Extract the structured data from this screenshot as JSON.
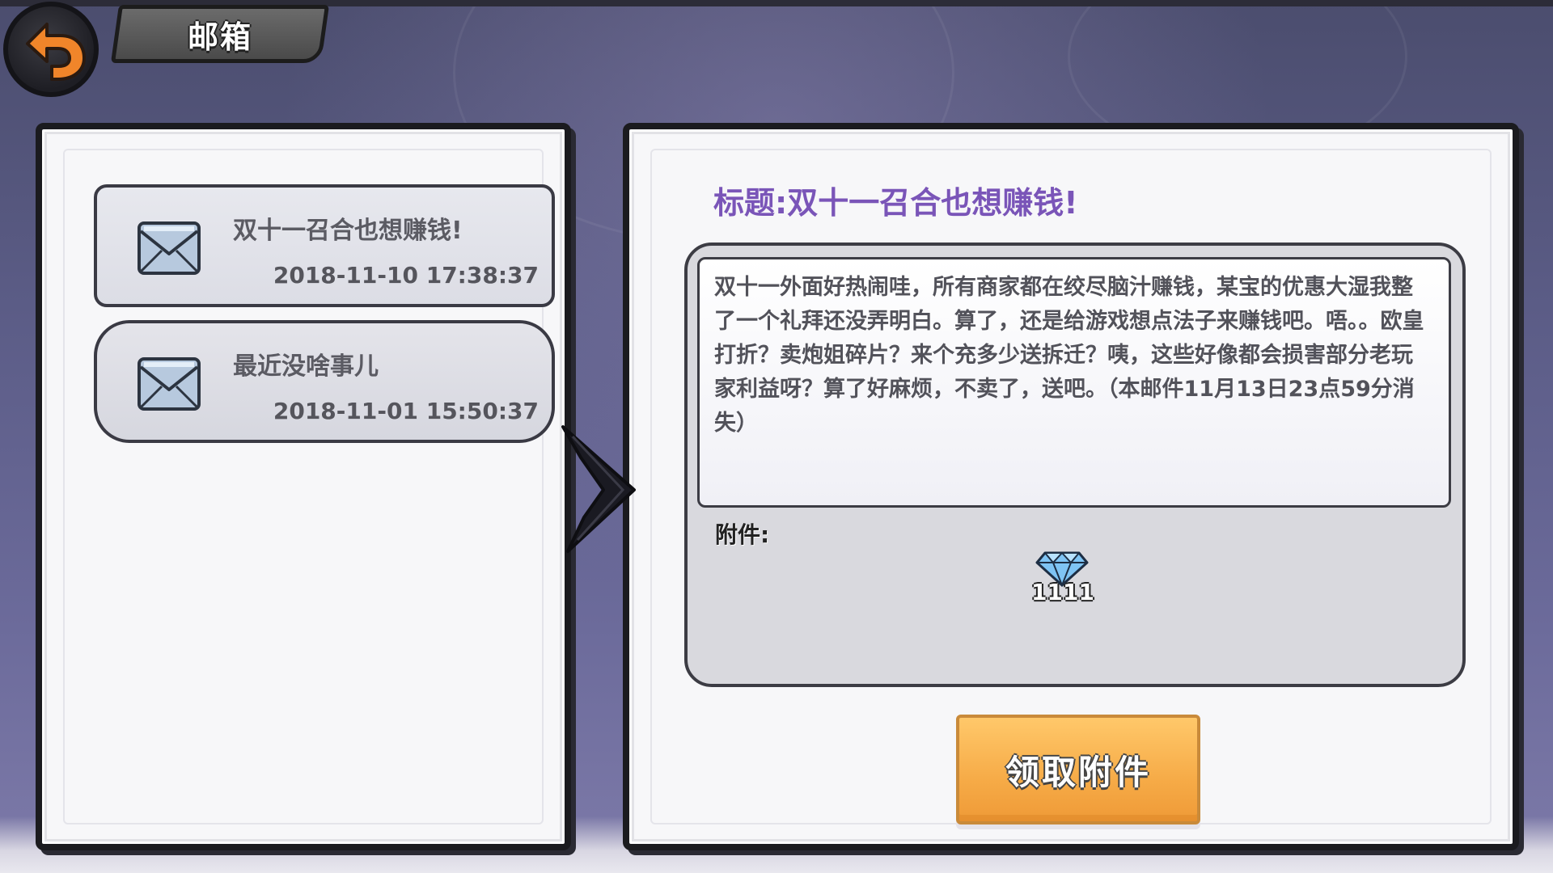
{
  "header": {
    "title": "邮箱",
    "back_icon": "back-arrow-icon"
  },
  "mail_list": {
    "items": [
      {
        "subject": "双十一召合也想赚钱!",
        "date": "2018-11-10 17:38:37",
        "icon": "envelope-icon"
      },
      {
        "subject": "最近没啥事儿",
        "date": "2018-11-01 15:50:37",
        "icon": "envelope-icon"
      }
    ]
  },
  "mail_detail": {
    "title_prefix": "标题:",
    "title": "双十一召合也想赚钱!",
    "body": "双十一外面好热闹哇，所有商家都在绞尽脑汁赚钱，某宝的优惠大湿我整了一个礼拜还没弄明白。算了，还是给游戏想点法子来赚钱吧。唔。。欧皇打折？卖炮姐碎片？来个充多少送拆迁？咦，这些好像都会损害部分老玩家利益呀？算了好麻烦，不卖了，送吧。（本邮件11月13日23点59分消失）",
    "attachment_label": "附件:",
    "attachments": [
      {
        "icon": "diamond-icon",
        "quantity": "1111"
      }
    ],
    "claim_button": "领取附件"
  },
  "colors": {
    "title_purple": "#7a55b8",
    "button_orange": "#f6ab47",
    "panel_border": "#1b1b1f"
  }
}
